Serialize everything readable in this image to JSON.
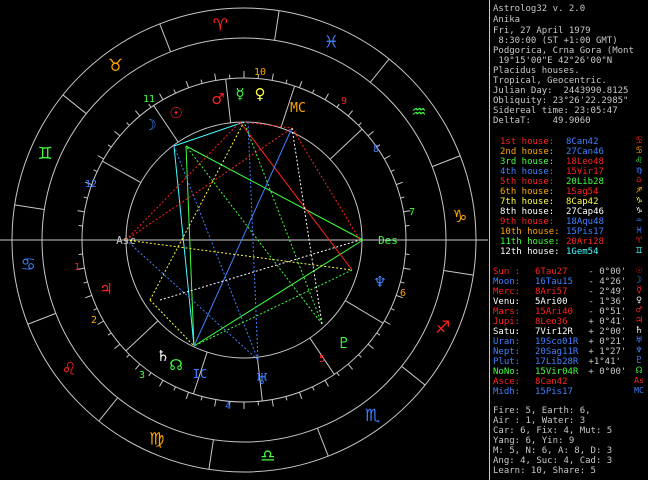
{
  "header": {
    "title": "Astrolog32 v. 2.0",
    "name": "Anika",
    "date": "Fri, 27 April 1979",
    "time": " 8:30:00 (ST +1:00 GMT)",
    "place": "Podgorica, Crna Gora (Mont",
    "coords": " 19°15'00\"E 42°26'00\"N",
    "system": "Placidus houses.",
    "zodiac": "Tropical, Geocentric.",
    "julian": "Julian Day:  2443990.8125",
    "obliquity": "Obliquity: 23°26'22.2985\"",
    "sidereal": "Sidereal time: 23:05:47",
    "delta": "DeltaT:    49.9060"
  },
  "houses": [
    {
      "label": "1st house:",
      "pos": "8Can42",
      "color": "#ff2020",
      "glyph": "♋",
      "gcolor": "#ff2020"
    },
    {
      "label": "2nd house:",
      "pos": "27Can46",
      "color": "#ffa500",
      "glyph": "♋",
      "gcolor": "#ffa500"
    },
    {
      "label": "3rd house:",
      "pos": "18Leo48",
      "color": "#40ff40",
      "glyph": "♌",
      "gcolor": "#40ff40"
    },
    {
      "label": "4th house:",
      "pos": "15Vir17",
      "color": "#4080ff",
      "glyph": "♍",
      "gcolor": "#4080ff"
    },
    {
      "label": "5th house:",
      "pos": "20Lib28",
      "color": "#ff2020",
      "glyph": "♎",
      "gcolor": "#ff2020"
    },
    {
      "label": "6th house:",
      "pos": "1Sag54",
      "color": "#ffa500",
      "glyph": "♐",
      "gcolor": "#ffa500"
    },
    {
      "label": "7th house:",
      "pos": "8Cap42",
      "color": "#ffff40",
      "glyph": "♑",
      "gcolor": "#ffff40"
    },
    {
      "label": "8th house:",
      "pos": "27Cap46",
      "color": "#ffffff",
      "glyph": "♑",
      "gcolor": "#ffffff"
    },
    {
      "label": "9th house:",
      "pos": "18Aqu48",
      "color": "#ff2020",
      "glyph": "♒",
      "gcolor": "#4080ff"
    },
    {
      "label": "10th house:",
      "pos": "15Pis17",
      "color": "#ffa500",
      "glyph": "♓",
      "gcolor": "#4080ff"
    },
    {
      "label": "11th house:",
      "pos": "20Ari28",
      "color": "#40ff40",
      "glyph": "♈",
      "gcolor": "#ff2020"
    },
    {
      "label": "12th house:",
      "pos": "1Gem54",
      "color": "#ffffff",
      "glyph": "♊",
      "gcolor": "#40ffff"
    }
  ],
  "house_pos_colors": [
    "#4080ff",
    "#4080ff",
    "#ff2020",
    "#ff2020",
    "#40ff40",
    "#ff2020",
    "#ffff40",
    "#ffffff",
    "#4080ff",
    "#4080ff",
    "#ff2020",
    "#40ffff"
  ],
  "planets": [
    {
      "label": "Sun :",
      "pos": "6Tau27",
      "aspect": " - 0°00'",
      "color": "#ff2020",
      "glyph": "☉"
    },
    {
      "label": "Moon:",
      "pos": "16Tau15",
      "aspect": " - 4°26'",
      "color": "#4080ff",
      "glyph": "☽"
    },
    {
      "label": "Merc:",
      "pos": "8Ari57",
      "aspect": " - 2°49'",
      "color": "#ff2020",
      "glyph": "☿"
    },
    {
      "label": "Venu:",
      "pos": "5Ari00",
      "aspect": " - 1°36'",
      "color": "#ffffff",
      "glyph": "♀"
    },
    {
      "label": "Mars:",
      "pos": "15Ari40",
      "aspect": " - 0°51'",
      "color": "#ff2020",
      "glyph": "♂"
    },
    {
      "label": "Jupi:",
      "pos": "8Leo36",
      "aspect": " + 0°41'",
      "color": "#ff2020",
      "glyph": "♃"
    },
    {
      "label": "Satu:",
      "pos": "7Vir12R",
      "aspect": " + 2°00'",
      "color": "#ffffff",
      "glyph": "♄"
    },
    {
      "label": "Uran:",
      "pos": "19Sco01R",
      "aspect": " + 0°21'",
      "color": "#4080ff",
      "glyph": "♅"
    },
    {
      "label": "Nept:",
      "pos": "20Sag11R",
      "aspect": " + 1°27'",
      "color": "#4080ff",
      "glyph": "♆"
    },
    {
      "label": "Plut:",
      "pos": "17Lib28R",
      "aspect": " +1°41'",
      "color": "#4080ff",
      "glyph": "♇"
    },
    {
      "label": "NoNo:",
      "pos": "15Vir04R",
      "aspect": " + 0°00'",
      "color": "#40ff40",
      "glyph": "☊"
    },
    {
      "label": "Asce:",
      "pos": "8Can42",
      "aspect": "",
      "color": "#ff2020",
      "glyph": "As"
    },
    {
      "label": "Midh:",
      "pos": "15Pis17",
      "aspect": "",
      "color": "#4080ff",
      "glyph": "MC"
    }
  ],
  "stats": [
    "Fire: 5, Earth: 6,",
    "Air : 1, Water: 3",
    "Car: 6, Fix: 4, Mut: 5",
    "Yang: 6, Yin: 9",
    "M: 5, N: 6, A: 8, D: 3",
    "Ang: 4, Suc: 4, Cad: 3",
    "Learn: 10, Share: 5"
  ],
  "wheel": {
    "ascendant_label": "Asc",
    "descendant_label": "Des",
    "ic_label": "IC",
    "mc_label": "MC",
    "house_numbers": [
      "1",
      "2",
      "3",
      "4",
      "5",
      "6",
      "7",
      "8",
      "9",
      "10",
      "11",
      "12"
    ],
    "signs": [
      {
        "glyph": "♈",
        "color": "#ff2020"
      },
      {
        "glyph": "♉",
        "color": "#ffa500"
      },
      {
        "glyph": "♊",
        "color": "#40ff40"
      },
      {
        "glyph": "♋",
        "color": "#4080ff"
      },
      {
        "glyph": "♌",
        "color": "#ff2020"
      },
      {
        "glyph": "♍",
        "color": "#ffa500"
      },
      {
        "glyph": "♎",
        "color": "#40ff40"
      },
      {
        "glyph": "♏",
        "color": "#4080ff"
      },
      {
        "glyph": "♐",
        "color": "#ff2020"
      },
      {
        "glyph": "♑",
        "color": "#ffa500"
      },
      {
        "glyph": "♒",
        "color": "#40ff40"
      },
      {
        "glyph": "♓",
        "color": "#4080ff"
      }
    ]
  }
}
